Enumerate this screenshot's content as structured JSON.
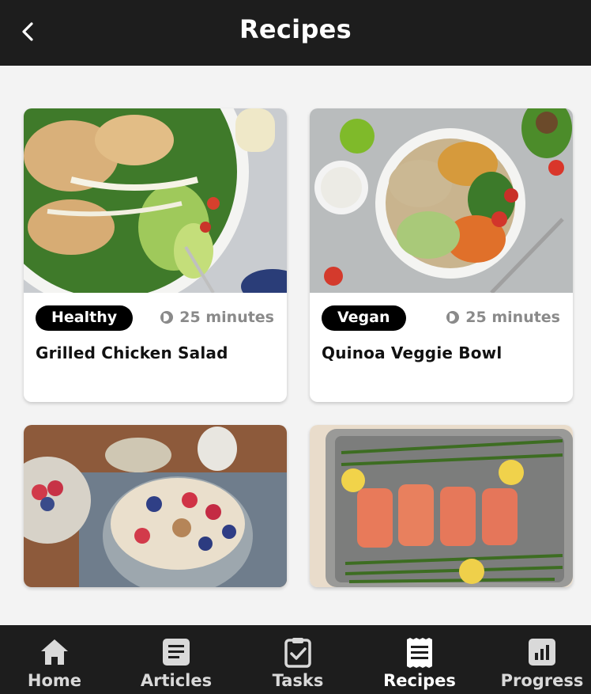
{
  "header": {
    "title": "Recipes"
  },
  "recipes": [
    {
      "tag": "Healthy",
      "time": "25 minutes",
      "name": "Grilled Chicken Salad"
    },
    {
      "tag": "Vegan",
      "time": "25 minutes",
      "name": "Quinoa Veggie Bowl"
    }
  ],
  "nav": [
    {
      "label": "Home",
      "icon": "home-icon"
    },
    {
      "label": "Articles",
      "icon": "article-icon"
    },
    {
      "label": "Tasks",
      "icon": "task-check-icon"
    },
    {
      "label": "Recipes",
      "icon": "receipt-icon",
      "active": true
    },
    {
      "label": "Progress",
      "icon": "chart-icon"
    }
  ],
  "colors": {
    "bar": "#1d1d1d",
    "tag_bg": "#000000",
    "muted": "#8a8a8a"
  }
}
